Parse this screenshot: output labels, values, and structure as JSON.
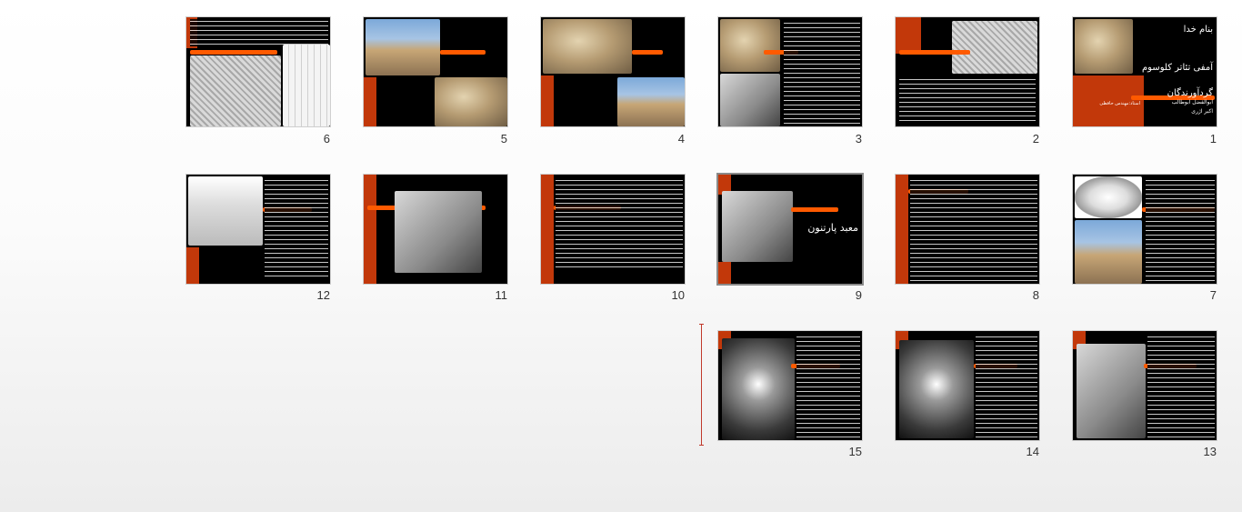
{
  "slides": [
    {
      "number": "1",
      "texts": [
        "بنام خدا",
        "آمفی تئاتر کلوسوم",
        "گردآورندگان",
        "ابوالفضل ابوطالب",
        "اکبر اژری",
        "استاد:مهندس حافظی"
      ]
    },
    {
      "number": "2"
    },
    {
      "number": "3"
    },
    {
      "number": "4"
    },
    {
      "number": "5"
    },
    {
      "number": "6"
    },
    {
      "number": "7"
    },
    {
      "number": "8"
    },
    {
      "number": "9",
      "texts": [
        "معبد پارتنون"
      ]
    },
    {
      "number": "10"
    },
    {
      "number": "11"
    },
    {
      "number": "12"
    },
    {
      "number": "13"
    },
    {
      "number": "14"
    },
    {
      "number": "15"
    }
  ],
  "colors": {
    "accent_red": "#c2380a",
    "accent_orange": "#ff5a00",
    "slide_bg": "#000000"
  }
}
